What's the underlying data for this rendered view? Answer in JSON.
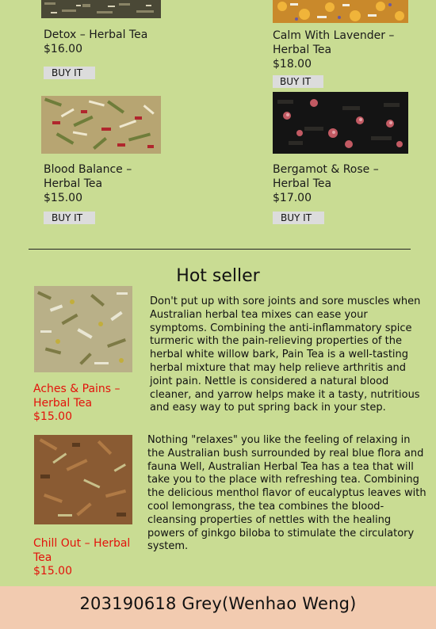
{
  "products": [
    {
      "name": "Detox – Herbal Tea",
      "price": "$16.00",
      "button": "BUY IT",
      "image": "detox-tea-image"
    },
    {
      "name": "Calm With Lavender – Herbal Tea",
      "price": "$18.00",
      "button": "BUY IT",
      "image": "lavender-tea-image"
    },
    {
      "name": "Blood Balance – Herbal Tea",
      "price": "$15.00",
      "button": "BUY IT",
      "image": "blood-balance-tea-image"
    },
    {
      "name": "Bergamot & Rose – Herbal Tea",
      "price": "$17.00",
      "button": "BUY IT",
      "image": "bergamot-rose-tea-image"
    }
  ],
  "hot_seller": {
    "title": "Hot seller",
    "items": [
      {
        "name": "Aches & Pains – Herbal Tea",
        "price": "$15.00",
        "description": "Don't put up with sore joints and sore muscles when Australian herbal tea mixes can ease your symptoms. Combining the anti-inflammatory spice turmeric with the pain-relieving properties of the herbal white willow bark, Pain Tea is a well-tasting herbal mixture that may help relieve arthritis and joint pain. Nettle is considered a natural blood cleaner, and yarrow helps make it a tasty, nutritious and easy way to put spring back in your step."
      },
      {
        "name": "Chill Out – Herbal Tea",
        "price": "$15.00",
        "description": "Nothing \"relaxes\" you like the feeling of relaxing in the Australian bush surrounded by real blue flora and fauna Well, Australian Herbal Tea has a tea that will take you to the place with refreshing tea. Combining the delicious menthol flavor of eucalyptus leaves with cool lemongrass, the tea combines the blood-cleansing properties of nettles with the healing powers of ginkgo biloba to stimulate the circulatory system."
      }
    ]
  },
  "footer": {
    "text": "203190618 Grey(Wenhao Weng)"
  },
  "colors": {
    "background": "#c9dc93",
    "accent_red": "#e3120b",
    "footer_bg": "#f2cbb0",
    "button_bg": "#dcdcdc"
  }
}
